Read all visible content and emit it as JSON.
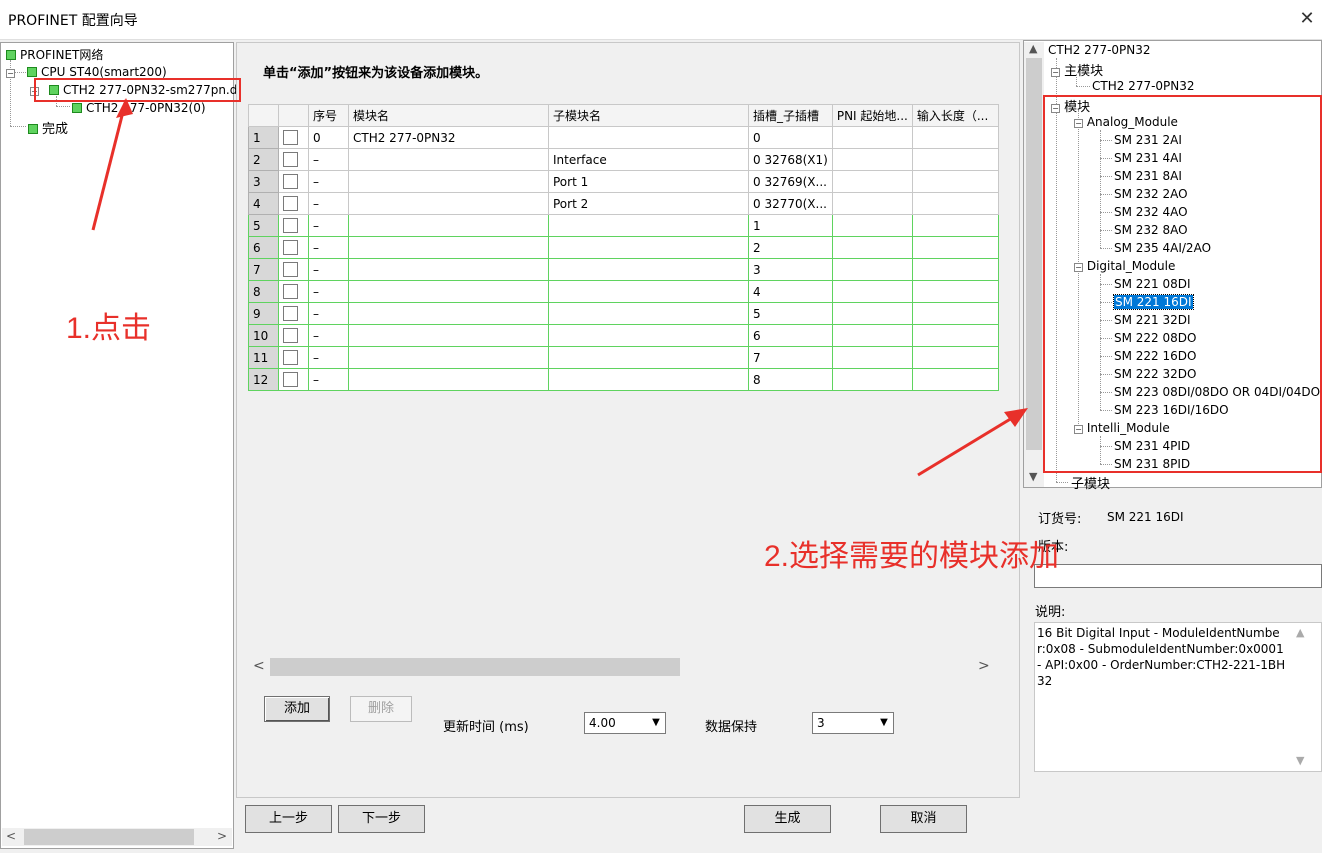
{
  "window": {
    "title": "PROFINET 配置向导",
    "close_label": "✕"
  },
  "left_tree": {
    "items": [
      {
        "label": "PROFINET网络"
      },
      {
        "label": "CPU ST40(smart200)"
      },
      {
        "label": "CTH2 277-0PN32-sm277pn.d"
      },
      {
        "label": "CTH2 277-0PN32(0)"
      },
      {
        "label": "完成"
      }
    ]
  },
  "center": {
    "instruction": "单击“添加”按钮来为该设备添加模块。",
    "columns": [
      "",
      "",
      "序号",
      "模块名",
      "子模块名",
      "插槽_子插槽",
      "PNI 起始地...",
      "输入长度（..."
    ],
    "rows": [
      {
        "num": "1",
        "seq": "0",
        "module": "CTH2 277-0PN32",
        "submodule": "",
        "slot": "0"
      },
      {
        "num": "2",
        "seq": "–",
        "module": "",
        "submodule": "Interface",
        "slot": "0 32768(X1)"
      },
      {
        "num": "3",
        "seq": "–",
        "module": "",
        "submodule": "Port 1",
        "slot": "0 32769(X..."
      },
      {
        "num": "4",
        "seq": "–",
        "module": "",
        "submodule": "Port 2",
        "slot": "0 32770(X..."
      },
      {
        "num": "5",
        "seq": "–",
        "module": "",
        "submodule": "",
        "slot": "1"
      },
      {
        "num": "6",
        "seq": "–",
        "module": "",
        "submodule": "",
        "slot": "2"
      },
      {
        "num": "7",
        "seq": "–",
        "module": "",
        "submodule": "",
        "slot": "3"
      },
      {
        "num": "8",
        "seq": "–",
        "module": "",
        "submodule": "",
        "slot": "4"
      },
      {
        "num": "9",
        "seq": "–",
        "module": "",
        "submodule": "",
        "slot": "5"
      },
      {
        "num": "10",
        "seq": "–",
        "module": "",
        "submodule": "",
        "slot": "6"
      },
      {
        "num": "11",
        "seq": "–",
        "module": "",
        "submodule": "",
        "slot": "7"
      },
      {
        "num": "12",
        "seq": "–",
        "module": "",
        "submodule": "",
        "slot": "8"
      }
    ],
    "add_label": "添加",
    "delete_label": "删除",
    "update_time_label": "更新时间 (ms)",
    "update_time_value": "4.00",
    "data_hold_label": "数据保持",
    "data_hold_value": "3",
    "scroll_left": "<",
    "scroll_right": ">"
  },
  "footer": {
    "prev_label": "上一步",
    "next_label": "下一步",
    "generate_label": "生成",
    "cancel_label": "取消"
  },
  "right_tree": {
    "root": "CTH2 277-0PN32",
    "main_module_group": "主模块",
    "main_module_item": "CTH2 277-0PN32",
    "modules_group": "模块",
    "analog_group": "Analog_Module",
    "analog_items": [
      "SM 231 2AI",
      "SM 231 4AI",
      "SM 231 8AI",
      "SM 232 2AO",
      "SM 232 4AO",
      "SM 232 8AO",
      "SM 235 4AI/2AO"
    ],
    "digital_group": "Digital_Module",
    "digital_items": [
      "SM 221 08DI",
      "SM 221 16DI",
      "SM 221 32DI",
      "SM 222 08DO",
      "SM 222 16DO",
      "SM 222 32DO",
      "SM 223 08DI/08DO OR 04DI/04DO",
      "SM 223 16DI/16DO"
    ],
    "selected_item": "SM 221 16DI",
    "intelli_group": "Intelli_Module",
    "intelli_items": [
      "SM 231 4PID",
      "SM 231 8PID"
    ],
    "submodule_group": "子模块"
  },
  "details": {
    "order_label": "订货号:",
    "order_value": "SM 221 16DI",
    "version_label": "版本:",
    "version_value": "",
    "description_label": "说明:",
    "description": "16 Bit Digital Input - ModuleIdentNumber:0x08 - SubmoduleIdentNumber:0x0001 - API:0x00 - OrderNumber:CTH2-221-1BH32"
  },
  "annotations": {
    "step1": "1.点击",
    "step2": "2.选择需要的模块添加"
  },
  "colors": {
    "annotation_red": "#e8302a",
    "selection_blue": "#0078d7",
    "tree_green": "#5fd35f"
  }
}
